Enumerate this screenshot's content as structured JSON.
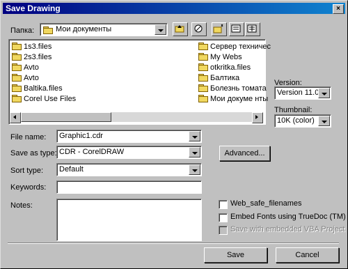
{
  "window": {
    "title": "Save Drawing",
    "close_glyph": "×"
  },
  "folder": {
    "label": "Папка:",
    "value": "Мои документы"
  },
  "toolbar": {
    "up_icon": "up-folder-icon",
    "desktop_icon": "desktop-icon",
    "new_folder_icon": "new-folder-icon",
    "list_icon": "list-view-icon",
    "details_icon": "details-view-icon"
  },
  "files": {
    "col1": [
      "1s3.files",
      "2s3.files",
      "Avto",
      "Avto",
      "Baltika.files",
      "Corel Use Files"
    ],
    "col2": [
      "Сервер техничес",
      "My Webs",
      "otkritka.files",
      "Балтика",
      "Болезнь томата",
      "Мои докуме нты"
    ]
  },
  "version": {
    "label": "Version:",
    "value": "Version 11.0"
  },
  "thumbnail": {
    "label": "Thumbnail:",
    "value": "10K (color)"
  },
  "file_name": {
    "label": "File name:",
    "value": "Graphic1.cdr"
  },
  "save_as_type": {
    "label": "Save as type:",
    "value": "CDR - CorelDRAW"
  },
  "sort_type": {
    "label": "Sort type:",
    "value": "Default"
  },
  "keywords": {
    "label": "Keywords:",
    "value": ""
  },
  "notes": {
    "label": "Notes:",
    "value": ""
  },
  "advanced_label": "Advanced...",
  "options": [
    {
      "label": "Web_safe_filenames",
      "disabled": false
    },
    {
      "label": "Embed Fonts using TrueDoc (TM)",
      "disabled": false
    },
    {
      "label": "Save with embedded VBA Project",
      "disabled": true
    }
  ],
  "buttons": {
    "save": "Save",
    "cancel": "Cancel"
  }
}
